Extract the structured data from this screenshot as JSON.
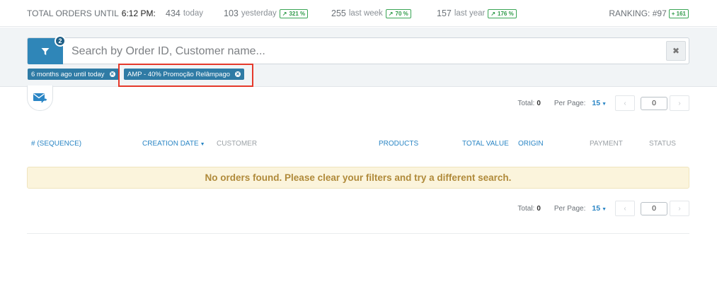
{
  "stats_bar": {
    "label": "TOTAL ORDERS UNTIL",
    "time": "6:12 PM:",
    "stats": [
      {
        "value": "434",
        "period": "today",
        "trend": ""
      },
      {
        "value": "103",
        "period": "yesterday",
        "trend": "321 %"
      },
      {
        "value": "255",
        "period": "last week",
        "trend": "70 %"
      },
      {
        "value": "157",
        "period": "last year",
        "trend": "176 %"
      }
    ],
    "ranking_label": "RANKING: #97",
    "ranking_delta": "+ 161"
  },
  "search": {
    "filter_count": "2",
    "placeholder": "Search by Order ID, Customer name...",
    "clear_label": "✖"
  },
  "active_filters": [
    {
      "label": "6 months ago until today"
    },
    {
      "label": "AMP - 40% Promoção Relâmpago"
    }
  ],
  "pagination": {
    "total_label": "Total:",
    "total_value": "0",
    "per_page_label": "Per Page:",
    "per_page_value": "15",
    "current_page": "0"
  },
  "table": {
    "columns": [
      {
        "label": "# (SEQUENCE)",
        "sortable": true
      },
      {
        "label": "CREATION DATE",
        "sortable": true
      },
      {
        "label": "CUSTOMER",
        "sortable": false
      },
      {
        "label": "PRODUCTS",
        "sortable": true
      },
      {
        "label": "TOTAL VALUE",
        "sortable": true
      },
      {
        "label": "ORIGIN",
        "sortable": true
      },
      {
        "label": "PAYMENT",
        "sortable": false
      },
      {
        "label": "STATUS",
        "sortable": false
      }
    ],
    "empty_message": "No orders found. Please clear your filters and try a different search."
  },
  "icons": {
    "filter": "filter-icon",
    "mail": "mail-forward-icon",
    "trend": "trend-up-icon"
  },
  "colors": {
    "accent": "#2f86b8",
    "trend_green": "#2e9a48",
    "notice_bg": "#fbf4dc",
    "notice_text": "#b08a3a",
    "highlight": "#e5392b"
  }
}
